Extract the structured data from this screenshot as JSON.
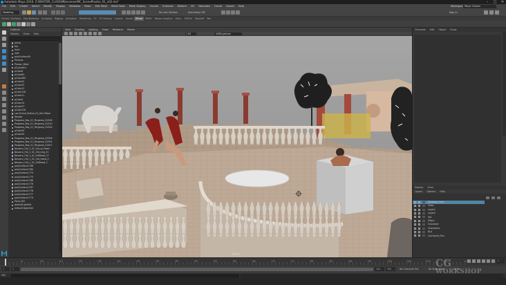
{
  "window": {
    "title": "Autodesk Maya 2016: Z:\\MASTER_CLASS\\Mb\\scenes\\MC_ScenePlaster_01_v02.ma*",
    "controls": [
      "–",
      "□",
      "✕"
    ]
  },
  "menubar": {
    "items": [
      "File",
      "Edit",
      "Create",
      "Select",
      "Modify",
      "Display",
      "Windows",
      "Mesh",
      "Edit Mesh",
      "Mesh Tools",
      "Mesh Display",
      "Curves",
      "Surfaces",
      "Deform",
      "UV",
      "Generate",
      "Cache",
      "Arnold",
      "Help"
    ],
    "workspace_label": "Workspace:",
    "workspace_value": "Maya Classic"
  },
  "statusline": {
    "mode": "Modeling",
    "no_live_surface": "No Live Surface",
    "symmetry": "Symmetry: Off",
    "sign_in": "Sign In"
  },
  "shelf": {
    "tabs": [
      "Curves / Surfaces",
      "Poly Modeling",
      "Sculpting",
      "Rigging",
      "Animation",
      "Rendering",
      "FX",
      "FX Caching",
      "Custom",
      "Arnold",
      "Bifrost",
      "MASH",
      "Motion Graphics",
      "XGen",
      "TURTLE",
      "Redshift",
      "Yeti"
    ],
    "active_tab_index": 10
  },
  "outliner": {
    "title": "Outliner",
    "menus": [
      "Display",
      "Show",
      "Help"
    ],
    "items": [
      "persp",
      "top",
      "front",
      "side",
      "polySurface40",
      "Perseus",
      "Pansoc_Base",
      "pCylinder1",
      "pCube6",
      "pCube83",
      "pCube465",
      "pCube52",
      "pCube25",
      "pCube13",
      "pCube126",
      "pCube11",
      "pCube4",
      "pCube19",
      "pCube57",
      "pCube126",
      "Loo-Grand_Statue_01_Hor+Base",
      "Temple",
      "Pergamo_Bas_01_Pergamo_02308",
      "Pergamo_Bas_01_Pergamo_02310",
      "Pergamo_Bas_01_Pergamo_02309",
      "pCube30",
      "pCube29",
      "Pergamo_Bas_01_Pergamo_02306",
      "Pergamo_Bas_01_Pergamo_02305",
      "Pergamo_Bas_01_Pergamo_02307",
      "Navarro_Old_1_01_Old_of_Head",
      "Navarro_Old_1_01_Old_Ang_01",
      "Navarro_Old_1_01_OldHead_27",
      "Navarro_Old_1_01_Old_Head_0",
      "Navarro_Old_1_01_OldHead_1",
      "polySurface1766",
      "polySurface1780",
      "polySurface1775",
      "polySurface1775",
      "polySurface1766",
      "polySurface1776",
      "polySurface1767",
      "polySurface1778",
      "polySurface1777",
      "polySurface1779",
      "Plane_BG",
      "defaultLightSet",
      "defaultObjectSet"
    ]
  },
  "viewport": {
    "menus": [
      "View",
      "Shading",
      "Lighting",
      "Show",
      "Renderer",
      "Panels"
    ],
    "gamma_value": "1.00",
    "color_space": "sRGB gamma",
    "camera_label": "persp"
  },
  "attribute_editor": {
    "tabs": [
      "Channels",
      "Edit",
      "Object",
      "Show"
    ]
  },
  "layers": {
    "tabs": [
      "Display",
      "Anim"
    ],
    "menus": [
      "Layers",
      "Options",
      "Help"
    ],
    "rows": [
      "Shadows_layer",
      "Trees",
      "Layer1",
      "Layer2",
      "Set",
      "Pillars",
      "Character",
      "Characters",
      "BLA",
      "Courtyard_Fixx"
    ],
    "selected_index": 0
  },
  "timeline": {
    "ticks": [
      "5",
      "10",
      "15",
      "20",
      "25",
      "30",
      "35",
      "40",
      "45",
      "50",
      "55",
      "60",
      "65",
      "70",
      "75",
      "80",
      "85",
      "90",
      "95",
      "100",
      "105",
      "110",
      "115",
      "120"
    ],
    "current_frame": "1"
  },
  "range_slider": {
    "start": "1",
    "range_start": "1",
    "range_end": "120",
    "end": "200",
    "no_character_set": "No Character Set",
    "no_anim_layer": "No Anim Layer",
    "fps": "24 fps"
  },
  "command_line": {
    "lang": "MEL"
  },
  "watermark": {
    "line1": "CG",
    "line2": "WORKSHOP"
  },
  "colors": {
    "selected_layer": "#5285a6",
    "sky": "#9c9c9c",
    "floor": "#b39f8d",
    "marble": "#d7cfc5",
    "column": "#8b3a30"
  }
}
